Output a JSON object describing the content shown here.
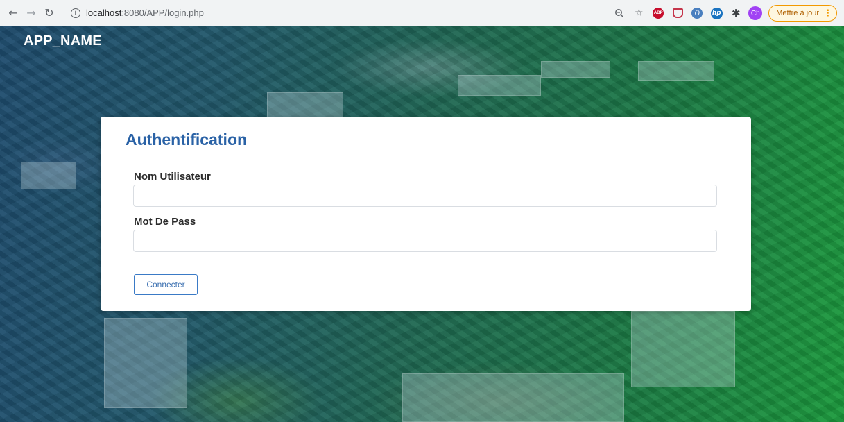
{
  "browser": {
    "url_host": "localhost",
    "url_path": ":8080/APP/login.php",
    "update_label": "Mettre à jour",
    "profile_initials": "Ch",
    "abp_label": "ABP",
    "hp_label": "hp"
  },
  "app": {
    "name": "APP_NAME"
  },
  "login": {
    "title": "Authentification",
    "username_label": "Nom Utilisateur",
    "username_value": "",
    "password_label": "Mot De Pass",
    "password_value": "",
    "submit_label": "Connecter"
  },
  "colors": {
    "title": "#2a62a6",
    "button_border": "#3a7ac6",
    "update_accent": "#f29900"
  }
}
